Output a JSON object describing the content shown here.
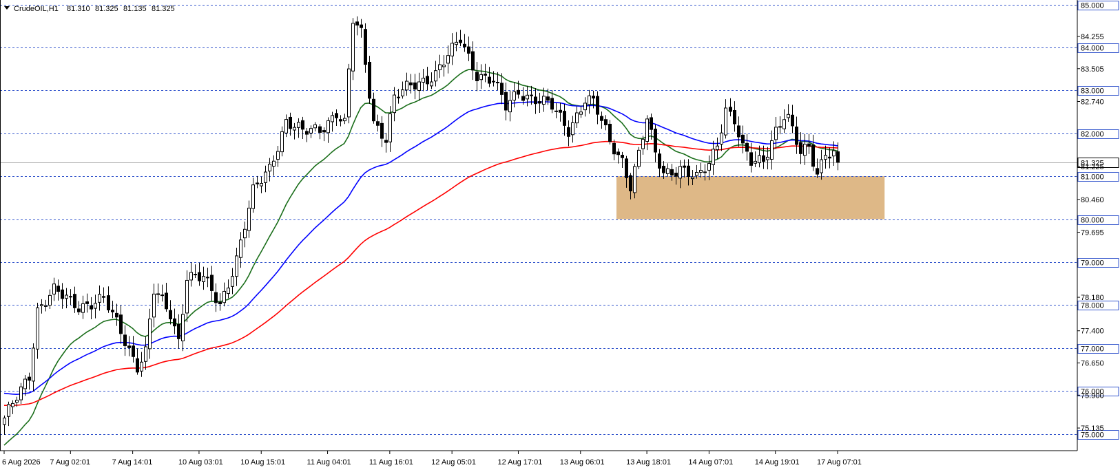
{
  "header": {
    "symbol_label": "CrudeOIL,H1",
    "ohlc": [
      "81.310",
      "81.325",
      "81.135",
      "81.325"
    ]
  },
  "colors": {
    "background": "#ffffff",
    "level_line": "#3355cc",
    "zone_fill": "#deb887",
    "ma_fast": "#1a6e1a",
    "ma_mid": "#0000ff",
    "ma_slow": "#ff0000",
    "candle": "#000000",
    "price_tag_bg": "#ffffff"
  },
  "chart_data": {
    "type": "candlestick",
    "symbol": "CrudeOIL",
    "timeframe": "H1",
    "ylim": [
      74.95,
      85.05
    ],
    "y_tick_labels": [
      "84.255",
      "83.505",
      "82.740",
      "81.225",
      "80.460",
      "79.695",
      "78.180",
      "77.400",
      "76.650",
      "75.900",
      "75.135"
    ],
    "level_labels": [
      "85.000",
      "84.000",
      "83.000",
      "82.000",
      "81.000",
      "80.000",
      "79.000",
      "78.000",
      "77.000",
      "76.000",
      "75.000"
    ],
    "current_price": "81.325",
    "x_tick_labels": [
      "6 Aug 2026",
      "7 Aug 02:01",
      "7 Aug 14:01",
      "10 Aug 03:01",
      "10 Aug 15:01",
      "11 Aug 04:01",
      "11 Aug 16:01",
      "12 Aug 05:01",
      "12 Aug 17:01",
      "13 Aug 06:01",
      "13 Aug 18:01",
      "14 Aug 07:01",
      "14 Aug 19:01",
      "17 Aug 07:01"
    ],
    "support_zone": {
      "from": 80.0,
      "to": 81.0,
      "start_bar": 148,
      "end_bar": 212
    },
    "anchors": [
      [
        0,
        75.3
      ],
      [
        6,
        76.4
      ],
      [
        8,
        77.9
      ],
      [
        12,
        78.3
      ],
      [
        18,
        78.0
      ],
      [
        24,
        78.1
      ],
      [
        28,
        77.4
      ],
      [
        32,
        76.6
      ],
      [
        34,
        76.9
      ],
      [
        36,
        78.3
      ],
      [
        40,
        77.8
      ],
      [
        42,
        77.2
      ],
      [
        44,
        78.7
      ],
      [
        48,
        78.6
      ],
      [
        52,
        78.0
      ],
      [
        56,
        79.1
      ],
      [
        60,
        80.6
      ],
      [
        64,
        81.2
      ],
      [
        68,
        82.3
      ],
      [
        72,
        82.0
      ],
      [
        76,
        82.1
      ],
      [
        80,
        82.5
      ],
      [
        82,
        82.2
      ],
      [
        84,
        84.6
      ],
      [
        86,
        84.3
      ],
      [
        89,
        82.3
      ],
      [
        92,
        81.9
      ],
      [
        94,
        82.8
      ],
      [
        98,
        83.1
      ],
      [
        104,
        83.4
      ],
      [
        108,
        83.9
      ],
      [
        110,
        84.2
      ],
      [
        114,
        83.4
      ],
      [
        118,
        83.2
      ],
      [
        121,
        82.6
      ],
      [
        124,
        83.0
      ],
      [
        128,
        82.8
      ],
      [
        132,
        82.6
      ],
      [
        136,
        82.1
      ],
      [
        140,
        82.8
      ],
      [
        142,
        82.7
      ],
      [
        146,
        81.8
      ],
      [
        149,
        81.4
      ],
      [
        151,
        80.8
      ],
      [
        153,
        81.5
      ],
      [
        155,
        82.3
      ],
      [
        157,
        81.5
      ],
      [
        159,
        81.1
      ],
      [
        163,
        81.2
      ],
      [
        167,
        80.9
      ],
      [
        170,
        81.3
      ],
      [
        172,
        81.8
      ],
      [
        174,
        82.6
      ],
      [
        176,
        82.3
      ],
      [
        178,
        81.6
      ],
      [
        180,
        81.3
      ],
      [
        183,
        81.4
      ],
      [
        186,
        82.1
      ],
      [
        188,
        82.4
      ],
      [
        189,
        82.3
      ],
      [
        192,
        81.5
      ],
      [
        194,
        81.7
      ],
      [
        196,
        81.1
      ],
      [
        198,
        81.6
      ],
      [
        200,
        81.5
      ],
      [
        201,
        81.3
      ]
    ],
    "series": [
      {
        "name": "",
        "period": 20,
        "color": "#1a6e1a"
      },
      {
        "name": "",
        "period": 50,
        "color": "#0000ff"
      },
      {
        "name": "",
        "period": 100,
        "color": "#ff0000"
      }
    ]
  }
}
